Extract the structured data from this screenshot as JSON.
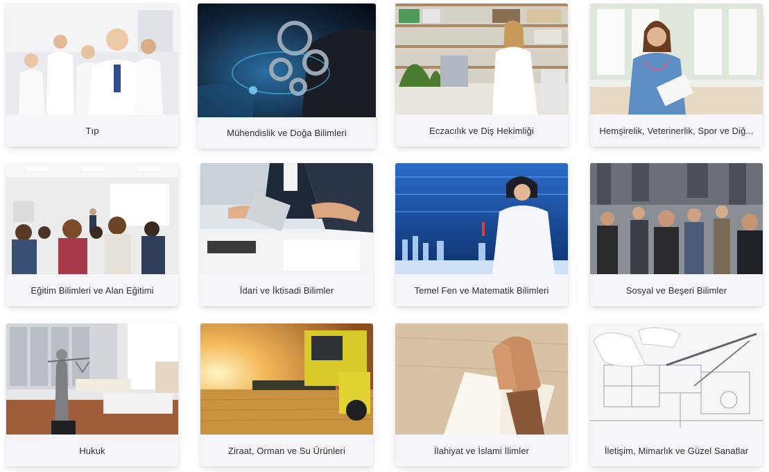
{
  "categories": [
    {
      "label": "Tıp",
      "image": "doctors-team-photo"
    },
    {
      "label": "Mühendislik ve Doğa Bilimleri",
      "image": "gears-hand-photo"
    },
    {
      "label": "Eczacılık ve Diş Hekimliği",
      "image": "pharmacist-photo"
    },
    {
      "label": "Hemşirelik, Veterinerlik, Spor ve Diğ...",
      "image": "nurse-photo"
    },
    {
      "label": "Eğitim Bilimleri ve Alan Eğitimi",
      "image": "classroom-audience-photo"
    },
    {
      "label": "İdari ve İktisadi Bilimler",
      "image": "business-meeting-photo"
    },
    {
      "label": "Temel Fen ve Matematik Bilimleri",
      "image": "lab-scientist-photo"
    },
    {
      "label": "Sosyal ve Beşeri Bilimler",
      "image": "street-crowd-photo"
    },
    {
      "label": "Hukuk",
      "image": "lady-justice-photo"
    },
    {
      "label": "Ziraat, Orman ve Su Ürünleri",
      "image": "harvester-field-photo"
    },
    {
      "label": "İlahiyat ve İslami İlimler",
      "image": "praying-hands-book-photo"
    },
    {
      "label": "İletişim, Mimarlık ve Güzel Sanatlar",
      "image": "architectural-plans-photo"
    }
  ]
}
